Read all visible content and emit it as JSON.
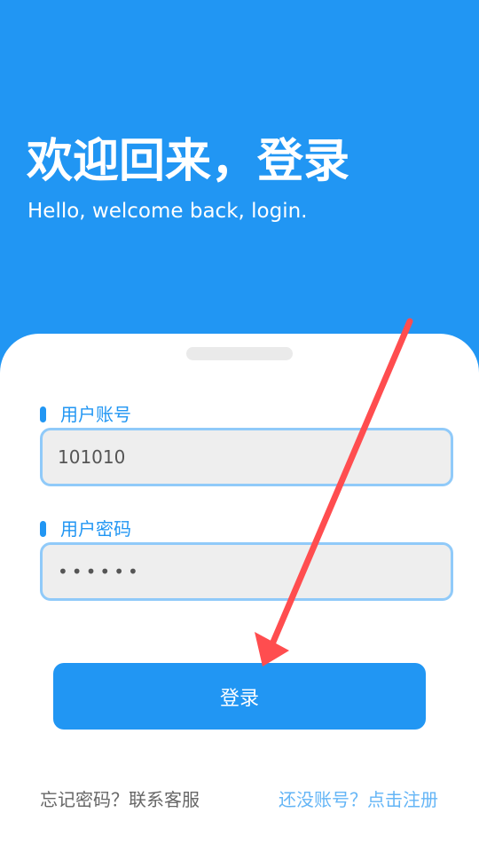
{
  "header": {
    "title": "欢迎回来，登录",
    "subtitle": "Hello, welcome back, login."
  },
  "form": {
    "account": {
      "label": "用户账号",
      "value": "101010"
    },
    "password": {
      "label": "用户密码",
      "masked_value": "••••••"
    },
    "login_button": "登录"
  },
  "footer": {
    "forgot_password": "忘记密码？联系客服",
    "register": "还没账号？点击注册"
  },
  "colors": {
    "primary": "#2196f3",
    "input_border": "#90caf9",
    "input_background": "#eeeeee",
    "annotation_arrow": "#ff4d4f"
  }
}
